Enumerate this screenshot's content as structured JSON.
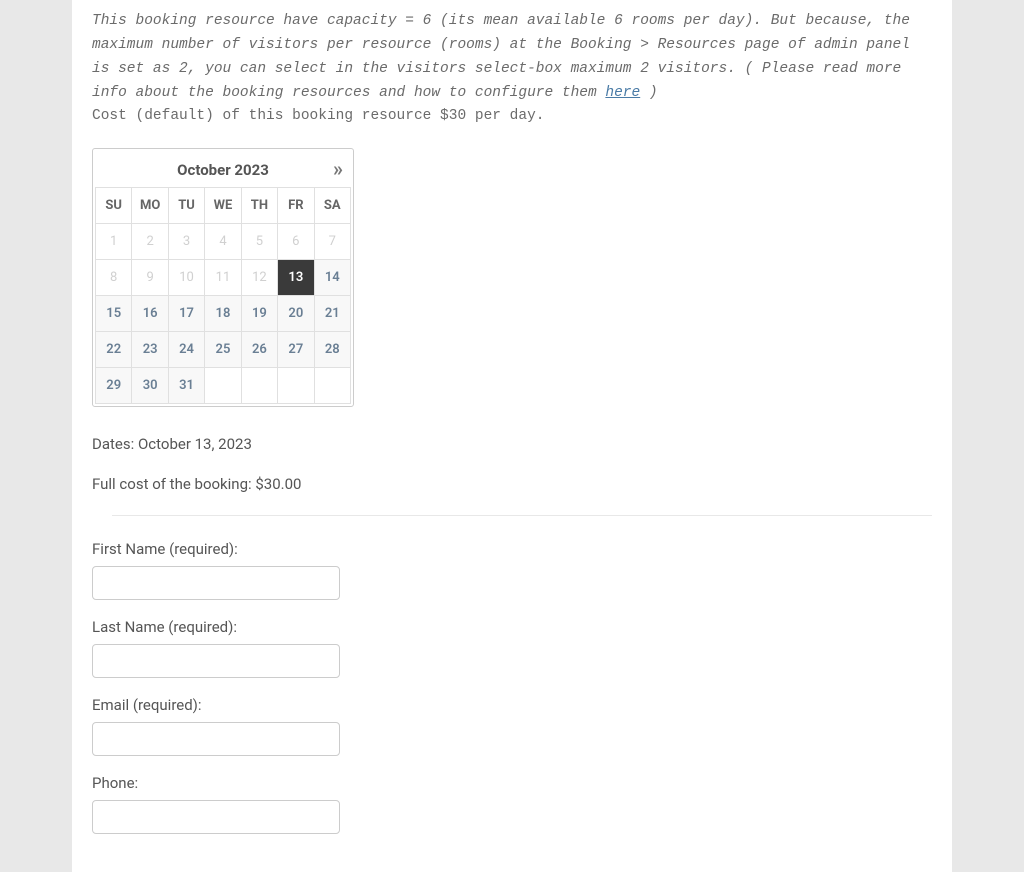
{
  "intro": {
    "text_before_link": "This booking resource have capacity = 6 (its mean available 6 rooms per day). But because, the maximum number of visitors per resource (rooms) at the Booking > Resources page of admin panel is set as 2, you can select in the visitors select-box maximum 2 visitors. ( Please read more info about the booking resources and how to configure them ",
    "link_text": "here",
    "text_after_link": " )"
  },
  "cost_line": "Cost (default) of this booking resource $30 per day.",
  "calendar": {
    "title": "October 2023",
    "next_glyph": "»",
    "days_of_week": [
      "SU",
      "MO",
      "TU",
      "WE",
      "TH",
      "FR",
      "SA"
    ],
    "weeks": [
      [
        {
          "n": "1",
          "s": "past"
        },
        {
          "n": "2",
          "s": "past"
        },
        {
          "n": "3",
          "s": "past"
        },
        {
          "n": "4",
          "s": "past"
        },
        {
          "n": "5",
          "s": "past"
        },
        {
          "n": "6",
          "s": "past"
        },
        {
          "n": "7",
          "s": "past"
        }
      ],
      [
        {
          "n": "8",
          "s": "past"
        },
        {
          "n": "9",
          "s": "past"
        },
        {
          "n": "10",
          "s": "past"
        },
        {
          "n": "11",
          "s": "past"
        },
        {
          "n": "12",
          "s": "past"
        },
        {
          "n": "13",
          "s": "today-selected"
        },
        {
          "n": "14",
          "s": "avail"
        }
      ],
      [
        {
          "n": "15",
          "s": "avail"
        },
        {
          "n": "16",
          "s": "avail"
        },
        {
          "n": "17",
          "s": "avail"
        },
        {
          "n": "18",
          "s": "avail"
        },
        {
          "n": "19",
          "s": "avail"
        },
        {
          "n": "20",
          "s": "avail"
        },
        {
          "n": "21",
          "s": "avail"
        }
      ],
      [
        {
          "n": "22",
          "s": "avail"
        },
        {
          "n": "23",
          "s": "avail"
        },
        {
          "n": "24",
          "s": "avail"
        },
        {
          "n": "25",
          "s": "avail"
        },
        {
          "n": "26",
          "s": "avail"
        },
        {
          "n": "27",
          "s": "avail"
        },
        {
          "n": "28",
          "s": "avail"
        }
      ],
      [
        {
          "n": "29",
          "s": "avail"
        },
        {
          "n": "30",
          "s": "avail"
        },
        {
          "n": "31",
          "s": "avail"
        },
        {
          "n": "",
          "s": "blank"
        },
        {
          "n": "",
          "s": "blank"
        },
        {
          "n": "",
          "s": "blank"
        },
        {
          "n": "",
          "s": "blank"
        }
      ]
    ]
  },
  "dates_line": "Dates: October 13, 2023",
  "fullcost_line": "Full cost of the booking: $30.00",
  "fields": {
    "first_name": {
      "label": "First Name (required):"
    },
    "last_name": {
      "label": "Last Name (required):"
    },
    "email": {
      "label": "Email (required):"
    },
    "phone": {
      "label": "Phone:"
    }
  }
}
